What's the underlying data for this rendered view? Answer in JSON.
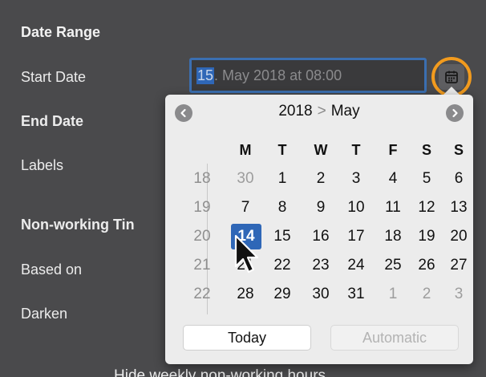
{
  "panel": {
    "title": "Date Range",
    "start_date_label": "Start Date",
    "end_date_label": "End Date",
    "labels_label": "Labels",
    "non_working_label": "Non-working Tin",
    "based_on_label": "Based on",
    "darken_label": "Darken",
    "footer_text": "Hide weekly non-working hours"
  },
  "start_date_field": {
    "selected_part": "15",
    "rest": ". May 2018 at 08:00"
  },
  "icons": {
    "calendar": "calendar-icon",
    "prev": "chevron-left-icon",
    "next": "chevron-right-icon",
    "cursor": "mouse-pointer-icon"
  },
  "calendar": {
    "year": "2018",
    "separator": ">",
    "month": "May",
    "weekdays": [
      "M",
      "T",
      "W",
      "T",
      "F",
      "S",
      "S"
    ],
    "weeks": [
      {
        "wk": "18",
        "days": [
          {
            "d": "30",
            "muted": true
          },
          {
            "d": "1"
          },
          {
            "d": "2"
          },
          {
            "d": "3"
          },
          {
            "d": "4"
          },
          {
            "d": "5"
          },
          {
            "d": "6"
          }
        ]
      },
      {
        "wk": "19",
        "days": [
          {
            "d": "7"
          },
          {
            "d": "8"
          },
          {
            "d": "9"
          },
          {
            "d": "10"
          },
          {
            "d": "11"
          },
          {
            "d": "12"
          },
          {
            "d": "13"
          }
        ]
      },
      {
        "wk": "20",
        "days": [
          {
            "d": "14",
            "selected": true
          },
          {
            "d": "15"
          },
          {
            "d": "16"
          },
          {
            "d": "17"
          },
          {
            "d": "18"
          },
          {
            "d": "19"
          },
          {
            "d": "20"
          }
        ]
      },
      {
        "wk": "21",
        "days": [
          {
            "d": "21"
          },
          {
            "d": "22"
          },
          {
            "d": "23"
          },
          {
            "d": "24"
          },
          {
            "d": "25"
          },
          {
            "d": "26"
          },
          {
            "d": "27"
          }
        ]
      },
      {
        "wk": "22",
        "days": [
          {
            "d": "28"
          },
          {
            "d": "29"
          },
          {
            "d": "30"
          },
          {
            "d": "31"
          },
          {
            "d": "1",
            "muted": true
          },
          {
            "d": "2",
            "muted": true
          },
          {
            "d": "3",
            "muted": true
          }
        ]
      }
    ],
    "today_label": "Today",
    "automatic_label": "Automatic"
  },
  "colors": {
    "accent": "#2f67b7",
    "highlight_ring": "#f29b1e"
  }
}
